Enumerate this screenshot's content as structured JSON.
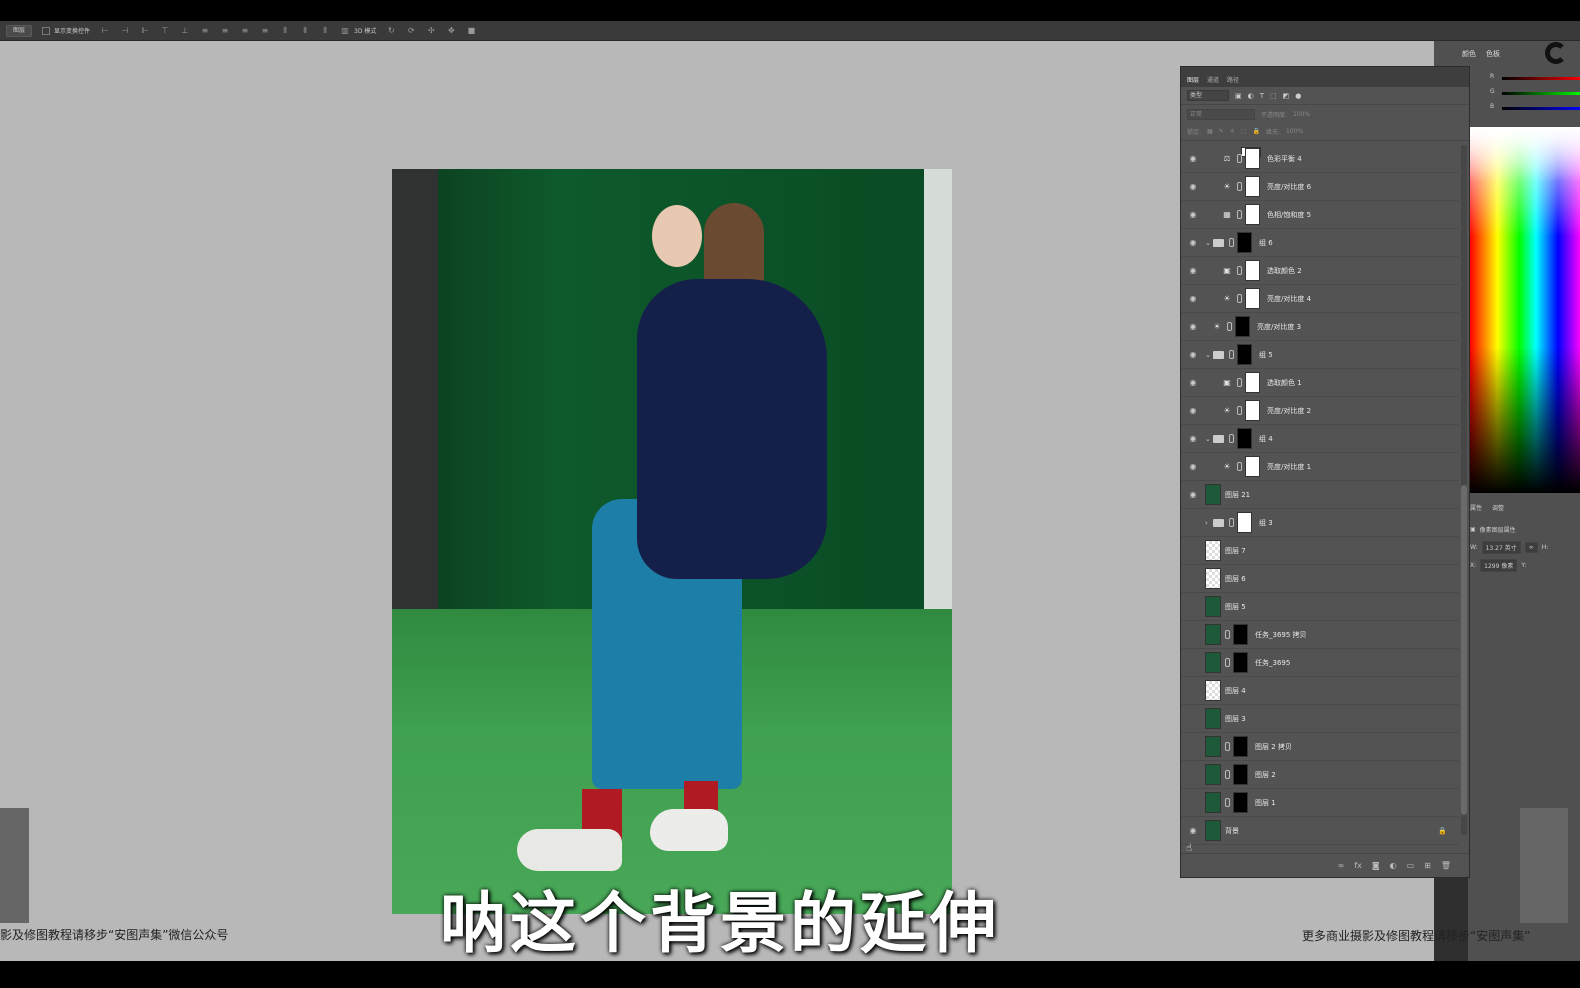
{
  "options_bar": {
    "layer_select": "图层",
    "show_transform": "显示变换控件",
    "mode_3d": "3D 模式"
  },
  "layers_panel": {
    "tabs": [
      "图层",
      "通道",
      "路径"
    ],
    "filter": "类型",
    "blend_mode": "正常",
    "opacity_label": "不透明度:",
    "opacity_value": "100%",
    "lock_label": "锁定:",
    "fill_label": "填充:",
    "fill_value": "100%",
    "layers": [
      {
        "name": "色彩平衡 4",
        "icon": "balance-icon"
      },
      {
        "name": "亮度/对比度 6",
        "icon": "sun-icon"
      },
      {
        "name": "色相/饱和度 5",
        "icon": "hue-icon"
      },
      {
        "name": "组 6",
        "icon": "folder-icon"
      },
      {
        "name": "选取颜色 2",
        "icon": "selective-color-icon"
      },
      {
        "name": "亮度/对比度 4",
        "icon": "sun-icon"
      },
      {
        "name": "亮度/对比度 3",
        "icon": "sun-icon"
      },
      {
        "name": "组 5",
        "icon": "folder-icon"
      },
      {
        "name": "选取颜色 1",
        "icon": "selective-color-icon"
      },
      {
        "name": "亮度/对比度 2",
        "icon": "sun-icon"
      },
      {
        "name": "组 4",
        "icon": "folder-icon"
      },
      {
        "name": "亮度/对比度 1",
        "icon": "sun-icon"
      },
      {
        "name": "图层 21",
        "icon": "image-icon"
      },
      {
        "name": "组 3",
        "icon": "folder-icon"
      },
      {
        "name": "图层 7",
        "icon": "image-icon"
      },
      {
        "name": "图层 6",
        "icon": "image-icon"
      },
      {
        "name": "图层 5",
        "icon": "image-icon"
      },
      {
        "name": "任务_3695 拷贝",
        "icon": "image-icon"
      },
      {
        "name": "任务_3695",
        "icon": "image-icon"
      },
      {
        "name": "图层 4",
        "icon": "image-icon"
      },
      {
        "name": "图层 3",
        "icon": "image-icon"
      },
      {
        "name": "图层 2 拷贝",
        "icon": "image-icon"
      },
      {
        "name": "图层 2",
        "icon": "image-icon"
      },
      {
        "name": "图层 1",
        "icon": "image-icon"
      },
      {
        "name": "背景",
        "icon": "image-icon"
      }
    ]
  },
  "right_panel": {
    "tabs": [
      "颜色",
      "色板"
    ],
    "channels": [
      "R",
      "G",
      "B"
    ],
    "props_tabs": [
      "属性",
      "调整"
    ],
    "props_title": "像素图层属性",
    "w_label": "W:",
    "w_value": "13.27 英寸",
    "h_label": "H:",
    "x_label": "X:",
    "x_value": "1299 像素",
    "y_label": "Y:"
  },
  "subtitle": "呐这个背景的延伸",
  "watermark_left": "影及修图教程请移步“安图声集”微信公众号",
  "watermark_right": "更多商业摄影及修图教程请移步“安图声集”",
  "colors": {
    "canvas_bg": "#b8b8b8",
    "panel_bg": "#535353",
    "green_backdrop": "#0e5a2c"
  }
}
